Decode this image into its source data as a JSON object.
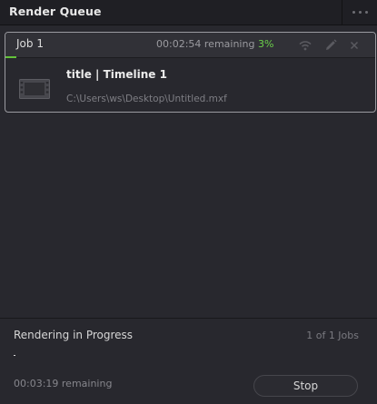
{
  "header": {
    "title": "Render Queue",
    "menu_icon": "more-dots-icon"
  },
  "job": {
    "name": "Job 1",
    "remaining": "00:02:54 remaining",
    "percent_label": "3%",
    "progress_fraction": 0.03,
    "title": "title | Timeline 1",
    "path": "C:\\Users\\ws\\Desktop\\Untitled.mxf",
    "icons": [
      "remote-render-icon",
      "edit-pencil-icon",
      "close-icon",
      "film-clip-icon"
    ]
  },
  "footer": {
    "status": "Rendering in Progress",
    "jobs_count": "1 of 1 Jobs",
    "progress_fraction": 0.005,
    "remaining": "00:03:19 remaining",
    "stop_label": "Stop"
  },
  "colors": {
    "background": "#28282e",
    "header_bg": "#1f1f24",
    "accent_green": "#63c23a",
    "card_border": "#9a9aa0"
  }
}
